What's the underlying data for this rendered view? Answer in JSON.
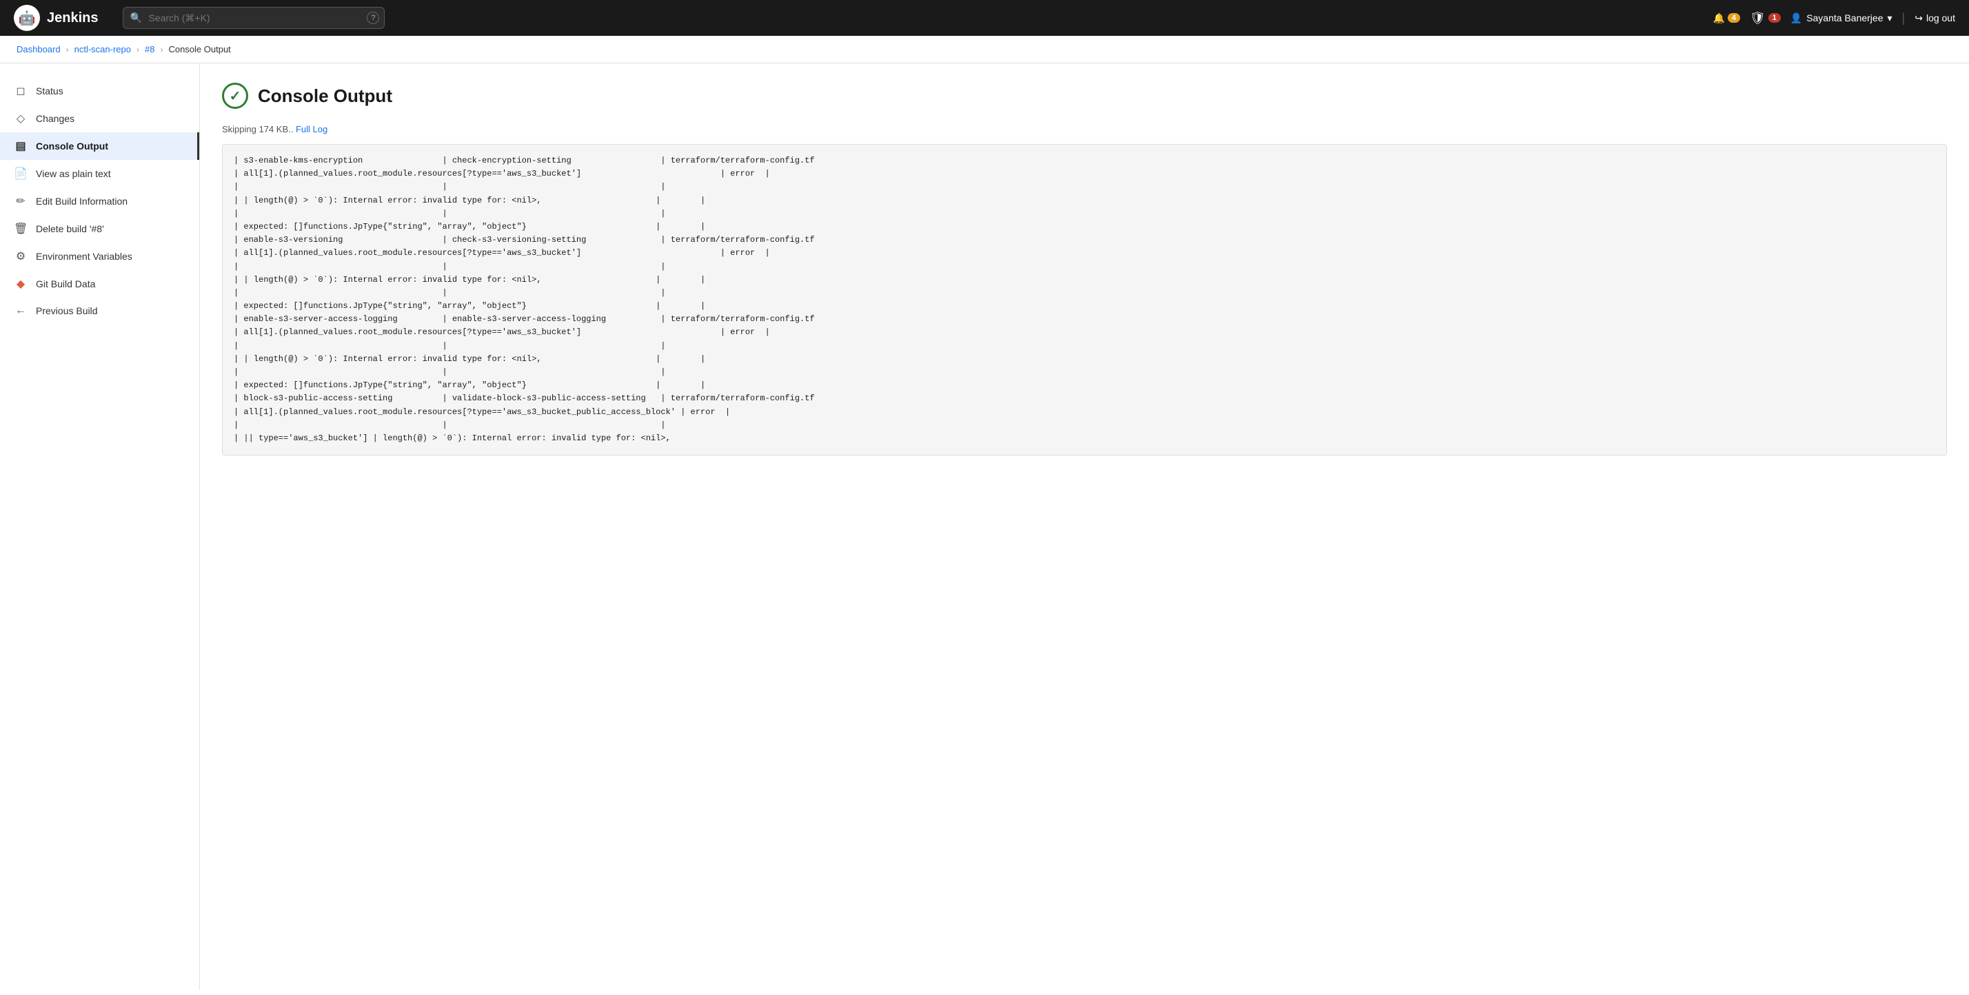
{
  "header": {
    "logo_text": "Jenkins",
    "search_placeholder": "Search (⌘+K)",
    "help_label": "?",
    "notifications_count": "4",
    "security_count": "1",
    "user_name": "Sayanta Banerjee",
    "logout_label": "log out"
  },
  "breadcrumb": {
    "dashboard": "Dashboard",
    "repo": "nctl-scan-repo",
    "build": "#8",
    "current": "Console Output"
  },
  "sidebar": {
    "items": [
      {
        "id": "status",
        "label": "Status",
        "icon": "📄"
      },
      {
        "id": "changes",
        "label": "Changes",
        "icon": "◇"
      },
      {
        "id": "console-output",
        "label": "Console Output",
        "icon": "🖥",
        "active": true
      },
      {
        "id": "view-plain-text",
        "label": "View as plain text",
        "icon": "📋"
      },
      {
        "id": "edit-build-info",
        "label": "Edit Build Information",
        "icon": "✏"
      },
      {
        "id": "delete-build",
        "label": "Delete build '#8'",
        "icon": "🗑"
      },
      {
        "id": "env-vars",
        "label": "Environment Variables",
        "icon": "⚙"
      },
      {
        "id": "git-build-data",
        "label": "Git Build Data",
        "icon": "◆",
        "git": true
      },
      {
        "id": "previous-build",
        "label": "Previous Build",
        "icon": "←"
      }
    ]
  },
  "content": {
    "title": "Console Output",
    "log_notice": "Skipping 174 KB.. ",
    "full_log_label": "Full Log",
    "console_lines": [
      "| s3-enable-kms-encryption                | check-encryption-setting                  | terraform/terraform-config.tf",
      "| all[1].(planned_values.root_module.resources[?type=='aws_s3_bucket']                            | error  |",
      "|                                         |                                           |",
      "| | length(@) > `0`): Internal error: invalid type for: <nil>,                       |        |",
      "|                                         |                                           |",
      "| expected: []functions.JpType{\"string\", \"array\", \"object\"}                          |        |",
      "| enable-s3-versioning                    | check-s3-versioning-setting               | terraform/terraform-config.tf",
      "| all[1].(planned_values.root_module.resources[?type=='aws_s3_bucket']                            | error  |",
      "|                                         |                                           |",
      "| | length(@) > `0`): Internal error: invalid type for: <nil>,                       |        |",
      "|                                         |                                           |",
      "| expected: []functions.JpType{\"string\", \"array\", \"object\"}                          |        |",
      "| enable-s3-server-access-logging         | enable-s3-server-access-logging           | terraform/terraform-config.tf",
      "| all[1].(planned_values.root_module.resources[?type=='aws_s3_bucket']                            | error  |",
      "|                                         |                                           |",
      "| | length(@) > `0`): Internal error: invalid type for: <nil>,                       |        |",
      "|                                         |                                           |",
      "| expected: []functions.JpType{\"string\", \"array\", \"object\"}                          |        |",
      "| block-s3-public-access-setting          | validate-block-s3-public-access-setting   | terraform/terraform-config.tf",
      "| all[1].(planned_values.root_module.resources[?type=='aws_s3_bucket_public_access_block' | error  |",
      "|                                         |                                           |",
      "| || type=='aws_s3_bucket'] | length(@) > `0`): Internal error: invalid type for: <nil>,"
    ]
  }
}
